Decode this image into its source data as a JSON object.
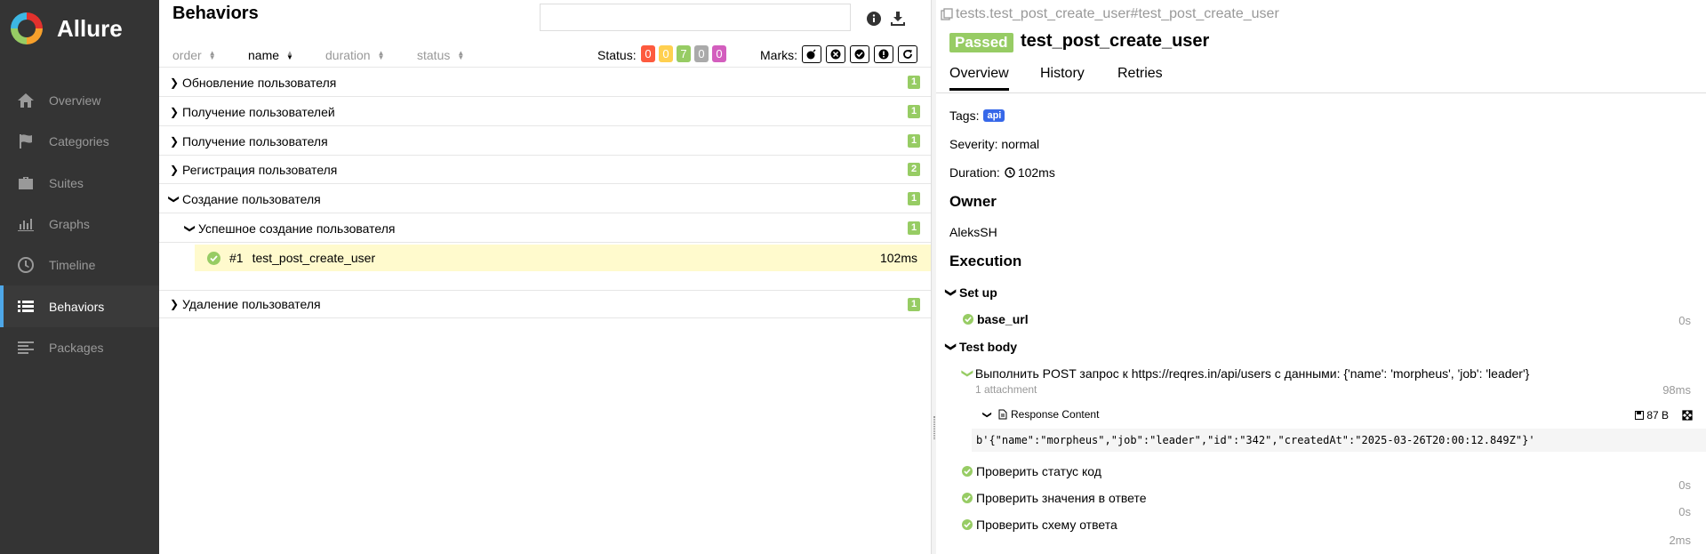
{
  "sidebar": {
    "brand": "Allure",
    "items": [
      {
        "label": "Overview",
        "icon": "home-icon"
      },
      {
        "label": "Categories",
        "icon": "flag-icon"
      },
      {
        "label": "Suites",
        "icon": "briefcase-icon"
      },
      {
        "label": "Graphs",
        "icon": "bar-chart-icon"
      },
      {
        "label": "Timeline",
        "icon": "clock-icon"
      },
      {
        "label": "Behaviors",
        "icon": "list-icon",
        "active": true
      },
      {
        "label": "Packages",
        "icon": "align-left-icon"
      }
    ]
  },
  "tree": {
    "title": "Behaviors",
    "search_value": "",
    "sort": {
      "order": "order",
      "name": "name",
      "duration": "duration",
      "status": "status"
    },
    "status_label": "Status:",
    "counters": [
      {
        "value": "0",
        "color": "#fd5a3e"
      },
      {
        "value": "0",
        "color": "#ffd050"
      },
      {
        "value": "7",
        "color": "#97cc64"
      },
      {
        "value": "0",
        "color": "#aaaaaa"
      },
      {
        "value": "0",
        "color": "#d35ebe"
      }
    ],
    "marks_label": "Marks:",
    "groups": [
      {
        "label": "Обновление пользователя",
        "count": "1"
      },
      {
        "label": "Получение пользователей",
        "count": "1"
      },
      {
        "label": "Получение пользователя",
        "count": "1"
      },
      {
        "label": "Регистрация пользователя",
        "count": "2"
      },
      {
        "label": "Создание пользователя",
        "count": "1"
      },
      {
        "label": "Успешное создание пользователя",
        "count": "1"
      },
      {
        "label": "Удаление пользователя",
        "count": "1"
      }
    ],
    "leaf": {
      "index": "#1",
      "name": "test_post_create_user",
      "duration": "102ms"
    }
  },
  "detail": {
    "breadcrumb": "tests.test_post_create_user#test_post_create_user",
    "status": "Passed",
    "title": "test_post_create_user",
    "tabs": [
      "Overview",
      "History",
      "Retries"
    ],
    "tags_label": "Tags:",
    "tag": "api",
    "severity": "Severity: normal",
    "duration_label": "Duration:",
    "duration_value": "102ms",
    "owner_heading": "Owner",
    "owner": "AleksSH",
    "execution_heading": "Execution",
    "setup_label": "Set up",
    "setup_step": {
      "name": "base_url",
      "duration": "0s"
    },
    "body_label": "Test body",
    "steps": [
      {
        "name": "Выполнить POST запрос к https://reqres.in/api/users с данными: {'name': 'morpheus', 'job': 'leader'}",
        "duration": "98ms"
      },
      {
        "name": "Проверить статус код",
        "duration": "0s"
      },
      {
        "name": "Проверить значения в ответе",
        "duration": "0s"
      },
      {
        "name": "Проверить схему ответа",
        "duration": "2ms"
      }
    ],
    "attachment_count": "1 attachment",
    "attachment_name": "Response Content",
    "attachment_size": "87 B",
    "attachment_body": "b'{\"name\":\"morpheus\",\"job\":\"leader\",\"id\":\"342\",\"createdAt\":\"2025-03-26T20:00:12.849Z\"}'"
  }
}
